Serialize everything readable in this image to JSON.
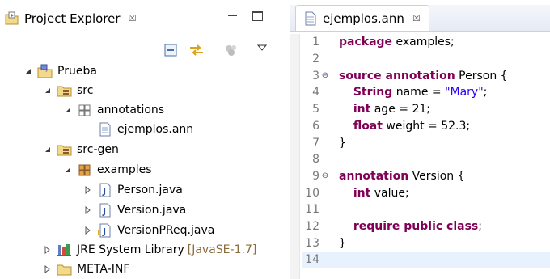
{
  "explorer": {
    "tab_title": "Project Explorer",
    "close_glyph": "☒",
    "tree": [
      {
        "id": "prueba",
        "label": "Prueba",
        "icon": "java-project-icon",
        "twisty": "expanded"
      },
      {
        "id": "src",
        "label": "src",
        "icon": "source-folder-icon",
        "twisty": "expanded"
      },
      {
        "id": "annotations",
        "label": "annotations",
        "icon": "empty-package-icon",
        "twisty": "expanded"
      },
      {
        "id": "ejemplos",
        "label": "ejemplos.ann",
        "icon": "file-icon",
        "twisty": "none"
      },
      {
        "id": "srcgen",
        "label": "src-gen",
        "icon": "source-folder-icon",
        "twisty": "expanded"
      },
      {
        "id": "examples",
        "label": "examples",
        "icon": "package-icon",
        "twisty": "expanded"
      },
      {
        "id": "person",
        "label": "Person.java",
        "icon": "java-file-icon",
        "twisty": "collapsed"
      },
      {
        "id": "version",
        "label": "Version.java",
        "icon": "java-file-icon",
        "twisty": "collapsed"
      },
      {
        "id": "versionpreq",
        "label": "VersionPReq.java",
        "icon": "java-file-icon",
        "twisty": "collapsed"
      },
      {
        "id": "jre",
        "label": "JRE System Library",
        "decoration": "[JavaSE-1.7]",
        "icon": "library-icon",
        "twisty": "collapsed"
      },
      {
        "id": "metainf",
        "label": "META-INF",
        "icon": "folder-icon",
        "twisty": "collapsed"
      }
    ]
  },
  "editor": {
    "tab_title": "ejemplos.ann",
    "close_glyph": "☒",
    "lines": [
      {
        "n": "1",
        "fold": "",
        "tokens": [
          {
            "t": "package",
            "c": "kw"
          },
          {
            "t": " examples;",
            "c": ""
          }
        ]
      },
      {
        "n": "2",
        "fold": "",
        "tokens": []
      },
      {
        "n": "3",
        "fold": "⊖",
        "tokens": [
          {
            "t": "source annotation",
            "c": "kw"
          },
          {
            "t": " Person {",
            "c": ""
          }
        ]
      },
      {
        "n": "4",
        "fold": "",
        "tokens": [
          {
            "t": "    ",
            "c": ""
          },
          {
            "t": "String",
            "c": "kw"
          },
          {
            "t": " name = ",
            "c": ""
          },
          {
            "t": "\"Mary\"",
            "c": "str"
          },
          {
            "t": ";",
            "c": ""
          }
        ]
      },
      {
        "n": "5",
        "fold": "",
        "tokens": [
          {
            "t": "    ",
            "c": ""
          },
          {
            "t": "int",
            "c": "kw"
          },
          {
            "t": " age = 21;",
            "c": ""
          }
        ]
      },
      {
        "n": "6",
        "fold": "",
        "tokens": [
          {
            "t": "    ",
            "c": ""
          },
          {
            "t": "float",
            "c": "kw"
          },
          {
            "t": " weight = 52.3;",
            "c": ""
          }
        ]
      },
      {
        "n": "7",
        "fold": "",
        "tokens": [
          {
            "t": "}",
            "c": ""
          }
        ]
      },
      {
        "n": "8",
        "fold": "",
        "tokens": []
      },
      {
        "n": "9",
        "fold": "⊖",
        "tokens": [
          {
            "t": "annotation",
            "c": "kw"
          },
          {
            "t": " Version {",
            "c": ""
          }
        ]
      },
      {
        "n": "10",
        "fold": "",
        "tokens": [
          {
            "t": "    ",
            "c": ""
          },
          {
            "t": "int",
            "c": "kw"
          },
          {
            "t": " value;",
            "c": ""
          }
        ]
      },
      {
        "n": "11",
        "fold": "",
        "tokens": []
      },
      {
        "n": "12",
        "fold": "",
        "tokens": [
          {
            "t": "    ",
            "c": ""
          },
          {
            "t": "require public class",
            "c": "kw"
          },
          {
            "t": ";",
            "c": ""
          }
        ]
      },
      {
        "n": "13",
        "fold": "",
        "tokens": [
          {
            "t": "}",
            "c": ""
          }
        ]
      },
      {
        "n": "14",
        "fold": "",
        "tokens": [],
        "current": true
      }
    ]
  },
  "colors": {
    "keyword": "#7f0055",
    "string": "#2a00ff",
    "current_line": "#e8f2fe",
    "decoration": "#8a6d3b"
  }
}
